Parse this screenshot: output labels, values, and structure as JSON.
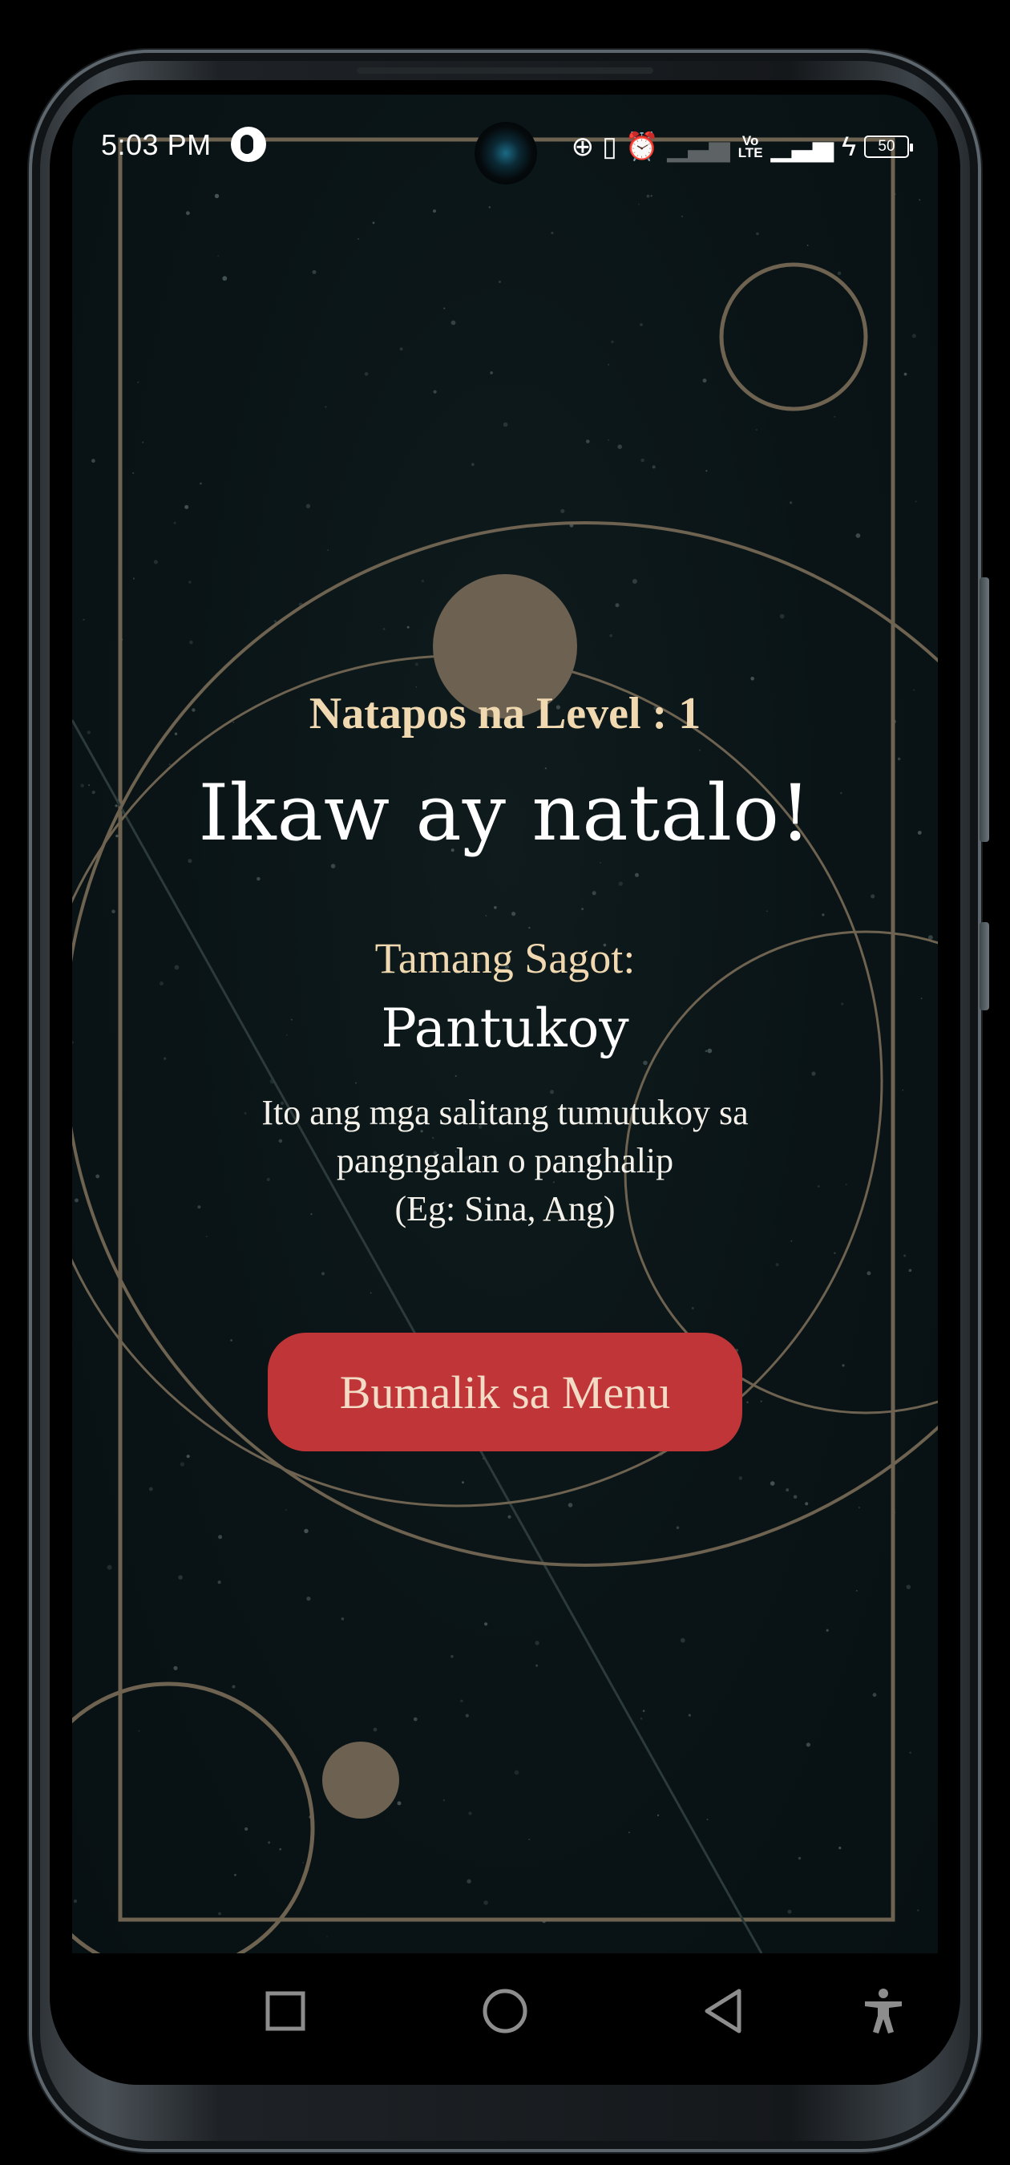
{
  "status_bar": {
    "time": "5:03 PM",
    "battery": "50",
    "volte_top": "Vo",
    "volte_bottom": "LTE",
    "icons": [
      "data-saver-icon",
      "vibrate-icon",
      "alarm-icon",
      "signal-icon",
      "charging-icon",
      "battery-icon"
    ]
  },
  "game": {
    "level_text": "Natapos na Level : 1",
    "result_title": "Ikaw ay natalo!",
    "answer_label": "Tamang Sagot:",
    "answer_word": "Pantukoy",
    "answer_description_lines": [
      "Ito ang mga salitang tumutukoy sa",
      "pangngalan o panghalip",
      "(Eg: Sina, Ang)"
    ],
    "menu_button_label": "Bumalik sa Menu"
  },
  "navigation": {
    "buttons": [
      "recents-icon",
      "home-icon",
      "back-icon",
      "accessibility-icon"
    ]
  },
  "colors": {
    "background": "#0a1416",
    "accent_gold": "#f0d9b0",
    "decor_line": "#6e6250",
    "button_red": "#c03538"
  }
}
